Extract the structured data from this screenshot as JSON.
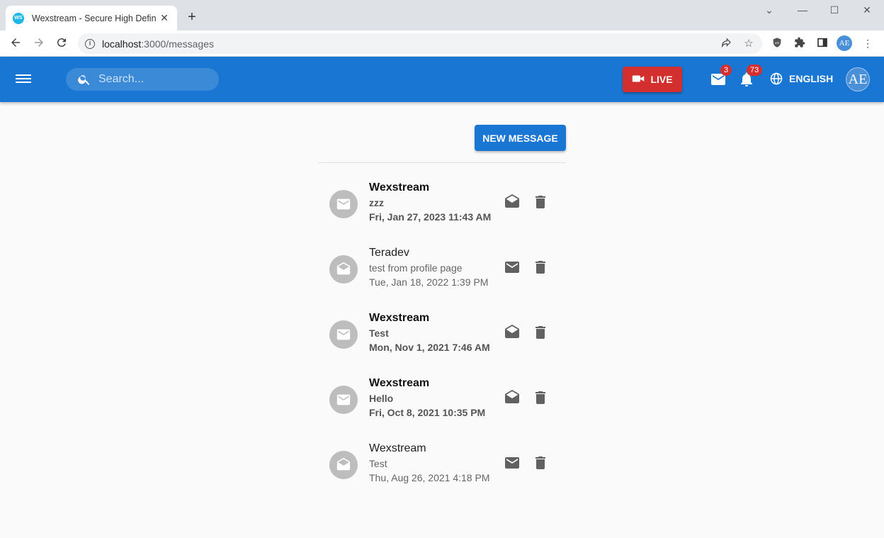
{
  "browser": {
    "tab_title": "Wexstream - Secure High Definition",
    "favicon_text": "WS",
    "url_host": "localhost",
    "url_path": ":3000/messages",
    "profile_initials": "AE"
  },
  "appbar": {
    "search_placeholder": "Search...",
    "live_label": "LIVE",
    "messages_badge": "3",
    "notifications_badge": "73",
    "language_label": "ENGLISH",
    "avatar_initials": "AE"
  },
  "content": {
    "new_message_label": "NEW MESSAGE",
    "messages": [
      {
        "sender": "Wexstream",
        "subject": "zzz",
        "date": "Fri, Jan 27, 2023 11:43 AM",
        "unread": true
      },
      {
        "sender": "Teradev",
        "subject": "test from profile page",
        "date": "Tue, Jan 18, 2022 1:39 PM",
        "unread": false
      },
      {
        "sender": "Wexstream",
        "subject": "Test",
        "date": "Mon, Nov 1, 2021 7:46 AM",
        "unread": true
      },
      {
        "sender": "Wexstream",
        "subject": "Hello",
        "date": "Fri, Oct 8, 2021 10:35 PM",
        "unread": true
      },
      {
        "sender": "Wexstream",
        "subject": "Test",
        "date": "Thu, Aug 26, 2021 4:18 PM",
        "unread": false
      }
    ]
  },
  "colors": {
    "primary": "#1976d2",
    "live": "#d32f2f",
    "icon_grey": "#616161",
    "avatar_grey": "#bdbdbd"
  }
}
